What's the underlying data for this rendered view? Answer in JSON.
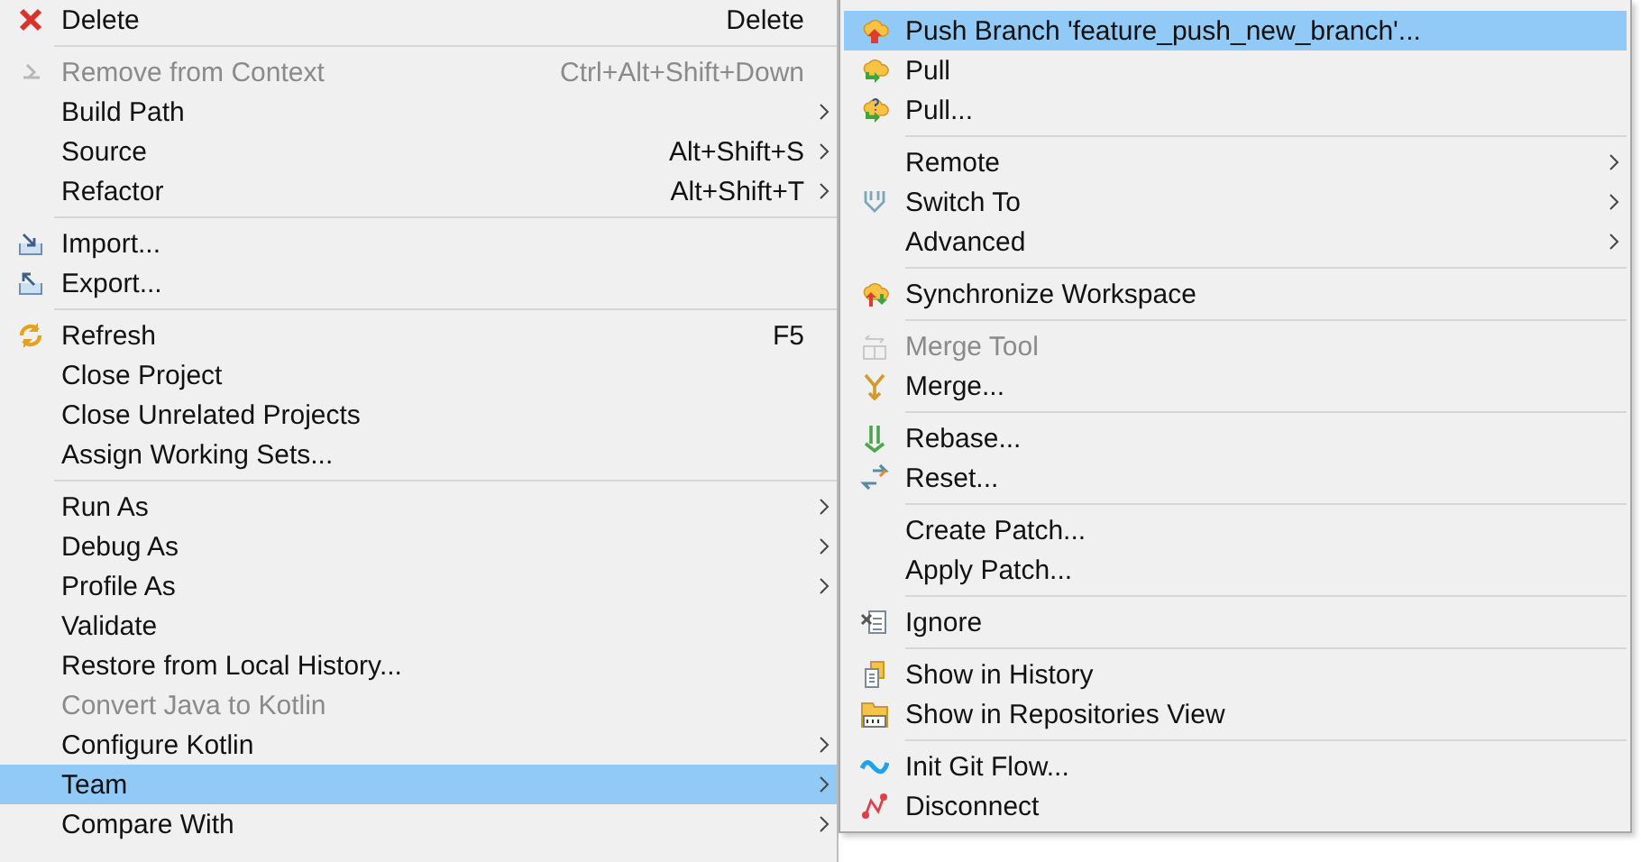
{
  "context_menu": {
    "items": [
      {
        "kind": "item",
        "label": "Delete",
        "shortcut": "Delete",
        "submenu": false,
        "disabled": false,
        "selected": false
      },
      {
        "kind": "separator"
      },
      {
        "kind": "item",
        "label": "Remove from Context",
        "shortcut": "Ctrl+Alt+Shift+Down",
        "submenu": false,
        "disabled": true,
        "selected": false
      },
      {
        "kind": "item",
        "label": "Build Path",
        "submenu": true,
        "disabled": false,
        "selected": false
      },
      {
        "kind": "item",
        "label": "Source",
        "shortcut": "Alt+Shift+S",
        "submenu": true,
        "disabled": false,
        "selected": false
      },
      {
        "kind": "item",
        "label": "Refactor",
        "shortcut": "Alt+Shift+T",
        "submenu": true,
        "disabled": false,
        "selected": false
      },
      {
        "kind": "separator"
      },
      {
        "kind": "item",
        "label": "Import...",
        "submenu": false,
        "disabled": false,
        "selected": false
      },
      {
        "kind": "item",
        "label": "Export...",
        "submenu": false,
        "disabled": false,
        "selected": false
      },
      {
        "kind": "separator"
      },
      {
        "kind": "item",
        "label": "Refresh",
        "shortcut": "F5",
        "submenu": false,
        "disabled": false,
        "selected": false
      },
      {
        "kind": "item",
        "label": "Close Project",
        "submenu": false,
        "disabled": false,
        "selected": false
      },
      {
        "kind": "item",
        "label": "Close Unrelated Projects",
        "submenu": false,
        "disabled": false,
        "selected": false
      },
      {
        "kind": "item",
        "label": "Assign Working Sets...",
        "submenu": false,
        "disabled": false,
        "selected": false
      },
      {
        "kind": "separator"
      },
      {
        "kind": "item",
        "label": "Run As",
        "submenu": true,
        "disabled": false,
        "selected": false
      },
      {
        "kind": "item",
        "label": "Debug As",
        "submenu": true,
        "disabled": false,
        "selected": false
      },
      {
        "kind": "item",
        "label": "Profile As",
        "submenu": true,
        "disabled": false,
        "selected": false
      },
      {
        "kind": "item",
        "label": "Validate",
        "submenu": false,
        "disabled": false,
        "selected": false
      },
      {
        "kind": "item",
        "label": "Restore from Local History...",
        "submenu": false,
        "disabled": false,
        "selected": false
      },
      {
        "kind": "item",
        "label": "Convert Java to Kotlin",
        "submenu": false,
        "disabled": true,
        "selected": false
      },
      {
        "kind": "item",
        "label": "Configure Kotlin",
        "submenu": true,
        "disabled": false,
        "selected": false
      },
      {
        "kind": "item",
        "label": "Team",
        "submenu": true,
        "disabled": false,
        "selected": true
      },
      {
        "kind": "item",
        "label": "Compare With",
        "submenu": true,
        "disabled": false,
        "selected": false
      }
    ]
  },
  "team_submenu": {
    "items": [
      {
        "kind": "item",
        "label": "Push Branch 'feature_push_new_branch'...",
        "submenu": false,
        "disabled": false,
        "selected": true
      },
      {
        "kind": "item",
        "label": "Pull",
        "submenu": false,
        "disabled": false,
        "selected": false
      },
      {
        "kind": "item",
        "label": "Pull...",
        "submenu": false,
        "disabled": false,
        "selected": false
      },
      {
        "kind": "separator"
      },
      {
        "kind": "item",
        "label": "Remote",
        "submenu": true,
        "disabled": false,
        "selected": false
      },
      {
        "kind": "item",
        "label": "Switch To",
        "submenu": true,
        "disabled": false,
        "selected": false
      },
      {
        "kind": "item",
        "label": "Advanced",
        "submenu": true,
        "disabled": false,
        "selected": false
      },
      {
        "kind": "separator"
      },
      {
        "kind": "item",
        "label": "Synchronize Workspace",
        "submenu": false,
        "disabled": false,
        "selected": false
      },
      {
        "kind": "separator"
      },
      {
        "kind": "item",
        "label": "Merge Tool",
        "submenu": false,
        "disabled": true,
        "selected": false
      },
      {
        "kind": "item",
        "label": "Merge...",
        "submenu": false,
        "disabled": false,
        "selected": false
      },
      {
        "kind": "separator"
      },
      {
        "kind": "item",
        "label": "Rebase...",
        "submenu": false,
        "disabled": false,
        "selected": false
      },
      {
        "kind": "item",
        "label": "Reset...",
        "submenu": false,
        "disabled": false,
        "selected": false
      },
      {
        "kind": "separator"
      },
      {
        "kind": "item",
        "label": "Create Patch...",
        "submenu": false,
        "disabled": false,
        "selected": false
      },
      {
        "kind": "item",
        "label": "Apply Patch...",
        "submenu": false,
        "disabled": false,
        "selected": false
      },
      {
        "kind": "separator"
      },
      {
        "kind": "item",
        "label": "Ignore",
        "submenu": false,
        "disabled": false,
        "selected": false
      },
      {
        "kind": "separator"
      },
      {
        "kind": "item",
        "label": "Show in History",
        "submenu": false,
        "disabled": false,
        "selected": false
      },
      {
        "kind": "item",
        "label": "Show in Repositories View",
        "submenu": false,
        "disabled": false,
        "selected": false
      },
      {
        "kind": "separator"
      },
      {
        "kind": "item",
        "label": "Init Git Flow...",
        "submenu": false,
        "disabled": false,
        "selected": false
      },
      {
        "kind": "item",
        "label": "Disconnect",
        "submenu": false,
        "disabled": false,
        "selected": false
      }
    ]
  }
}
